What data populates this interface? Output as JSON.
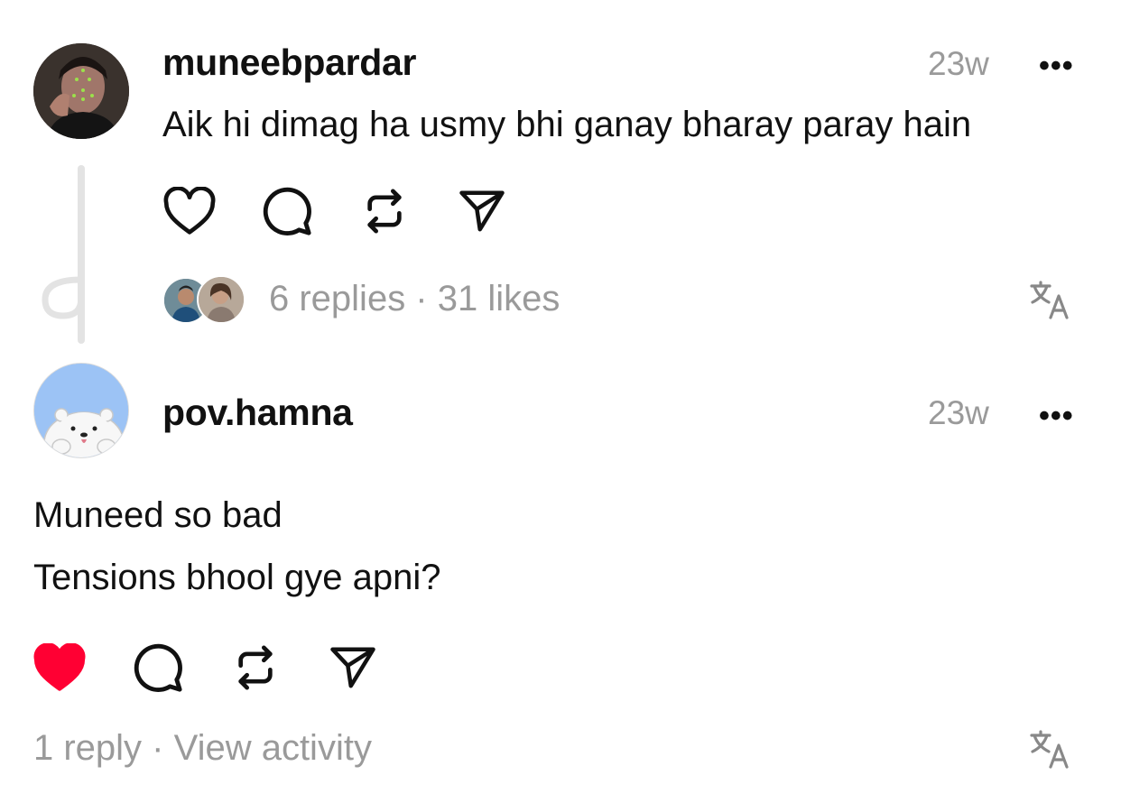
{
  "posts": [
    {
      "username": "muneebpardar",
      "time": "23w",
      "more": "•••",
      "lines": [
        "Aik hi dimag ha usmy bhi ganay bharay paray hain"
      ],
      "liked": false,
      "meta": "6 replies · 31 likes"
    },
    {
      "username": "pov.hamna",
      "time": "23w",
      "more": "•••",
      "lines": [
        "Muneed so bad",
        "Tensions bhool gye apni?"
      ],
      "liked": true,
      "meta": "1 reply · View activity"
    }
  ],
  "icons": {
    "like": "heart-icon",
    "comment": "comment-bubble-icon",
    "repost": "repost-icon",
    "share": "send-icon",
    "translate": "translate-icon"
  },
  "colors": {
    "liked": "#ff0033",
    "muted_text": "#9a9a9a",
    "thread_line": "#e3e3e3"
  }
}
